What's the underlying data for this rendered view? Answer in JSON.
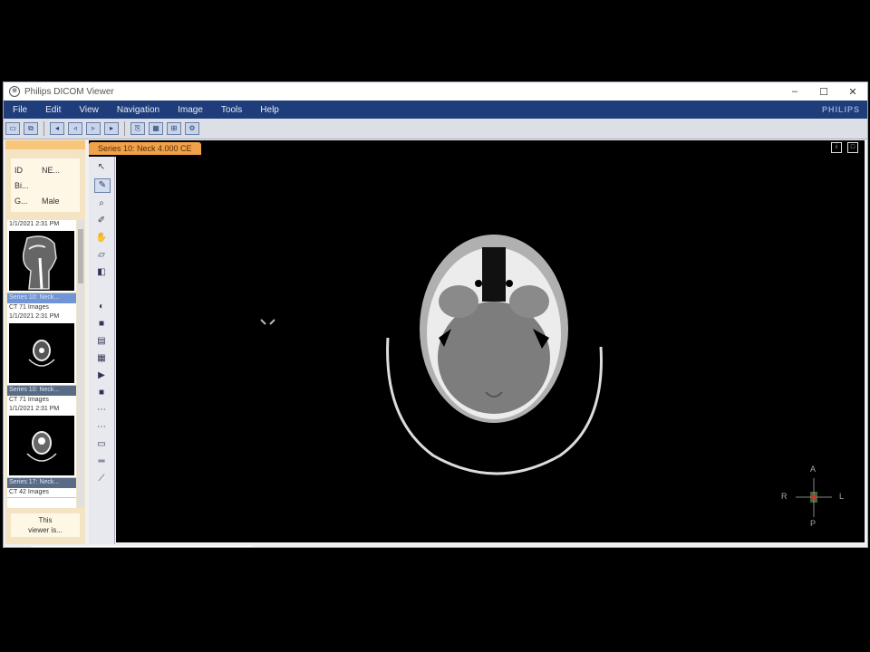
{
  "window": {
    "title": "Philips DICOM Viewer",
    "minimize": "–",
    "maximize": "☐",
    "close": "✕"
  },
  "menu": {
    "items": [
      "File",
      "Edit",
      "View",
      "Navigation",
      "Image",
      "Tools",
      "Help"
    ],
    "brand": "PHILIPS"
  },
  "patient": {
    "rows": [
      {
        "key": "ID",
        "value": "NE..."
      },
      {
        "key": "Bi...",
        "value": ""
      },
      {
        "key": "G...",
        "value": "Male"
      }
    ]
  },
  "series": [
    {
      "header": "",
      "line1": "1/1/2021 2:31 PM",
      "line2": "",
      "selected": false,
      "thumb": "sagittal"
    },
    {
      "header": "Series 10: Neck...",
      "line1": "CT 71 Images",
      "line2": "1/1/2021 2:31 PM",
      "selected": true,
      "thumb": "axial"
    },
    {
      "header": "Series 10: Neck...",
      "line1": "CT 71 Images",
      "line2": "1/1/2021 2:31 PM",
      "selected": false,
      "thumb": "axial"
    },
    {
      "header": "Series 17: Neck...",
      "line1": "CT 42 Images",
      "line2": "",
      "selected": false,
      "thumb": "none"
    }
  ],
  "viewer_note": {
    "line1": "This",
    "line2": "viewer is..."
  },
  "viewport": {
    "series_tab": "Series 10: Neck 4.000 CE",
    "orientation": {
      "anterior": "A",
      "posterior": "P",
      "right": "R",
      "left": "L"
    }
  },
  "colors": {
    "menubar": "#1f3d7a",
    "tab": "#f0a24a",
    "panel": "#f4e4c4"
  }
}
